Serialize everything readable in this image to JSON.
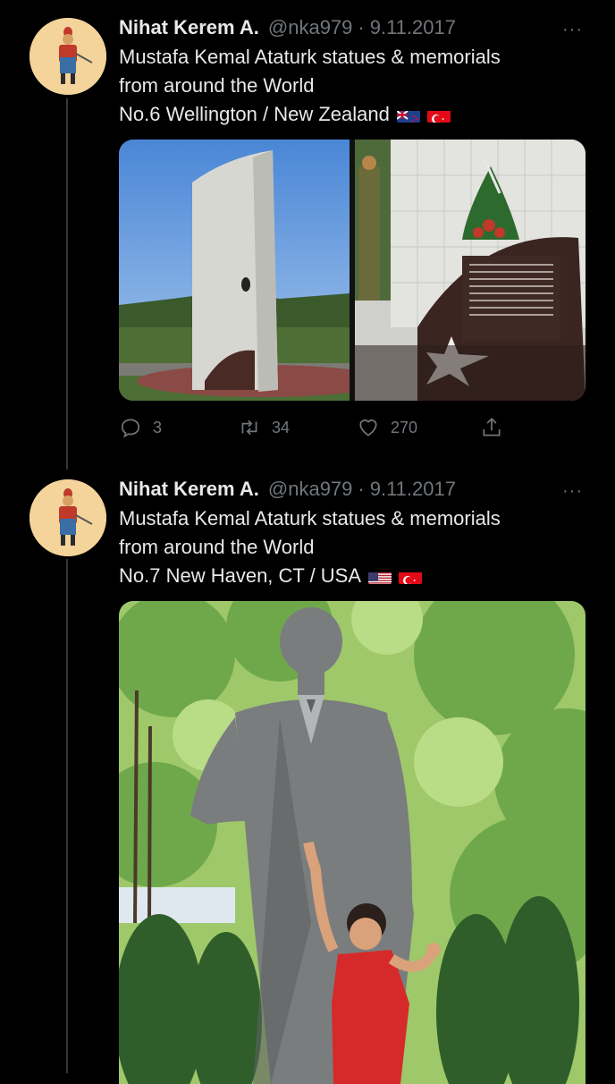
{
  "tweets": [
    {
      "author_name": "Nihat Kerem A.",
      "handle": "@nka979",
      "separator": "·",
      "date": "9.11.2017",
      "more": "···",
      "lines": [
        "Mustafa Kemal Ataturk statues & memorials",
        "from around the World",
        "No.6 Wellington / New Zealand"
      ],
      "flags": [
        "new-zealand-flag",
        "turkey-flag"
      ],
      "stats": {
        "replies": "3",
        "retweets": "34",
        "likes": "270"
      }
    },
    {
      "author_name": "Nihat Kerem A.",
      "handle": "@nka979",
      "separator": "·",
      "date": "9.11.2017",
      "more": "···",
      "lines": [
        "Mustafa Kemal Ataturk statues & memorials",
        "from around the World",
        "No.7 New Haven, CT / USA"
      ],
      "flags": [
        "usa-flag",
        "turkey-flag"
      ]
    }
  ],
  "icons": {
    "reply": "reply-icon",
    "retweet": "retweet-icon",
    "like": "heart-icon",
    "share": "share-icon"
  },
  "colors": {
    "background": "#000000",
    "text": "#e7e9ea",
    "secondary": "#71767b",
    "thread_line": "#333639"
  }
}
